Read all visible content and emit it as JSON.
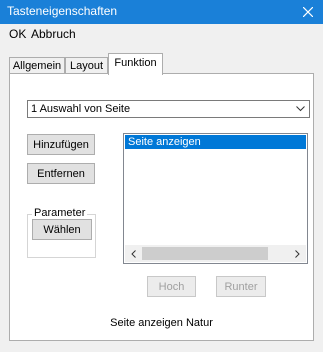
{
  "window": {
    "title": "Tasteneigenschaften"
  },
  "menu": {
    "ok": "OK",
    "cancel": "Abbruch"
  },
  "tabs": [
    {
      "label": "Allgemein"
    },
    {
      "label": "Layout"
    },
    {
      "label": "Funktion"
    }
  ],
  "function_select": {
    "value": "1 Auswahl von Seite"
  },
  "buttons": {
    "add": "Hinzufügen",
    "remove": "Entfernen",
    "choose": "Wählen",
    "up": "Hoch",
    "down": "Runter"
  },
  "parameter_group": {
    "legend": "Parameter"
  },
  "function_list": {
    "items": [
      "Seite anzeigen"
    ]
  },
  "status_text": "Seite anzeigen Natur",
  "colors": {
    "titlebar": "#1a80d8",
    "selection": "#0078d7"
  },
  "icons": {
    "close": "close-icon",
    "dropdown": "chevron-down-icon",
    "scroll_left": "chevron-left-icon",
    "scroll_right": "chevron-right-icon"
  }
}
